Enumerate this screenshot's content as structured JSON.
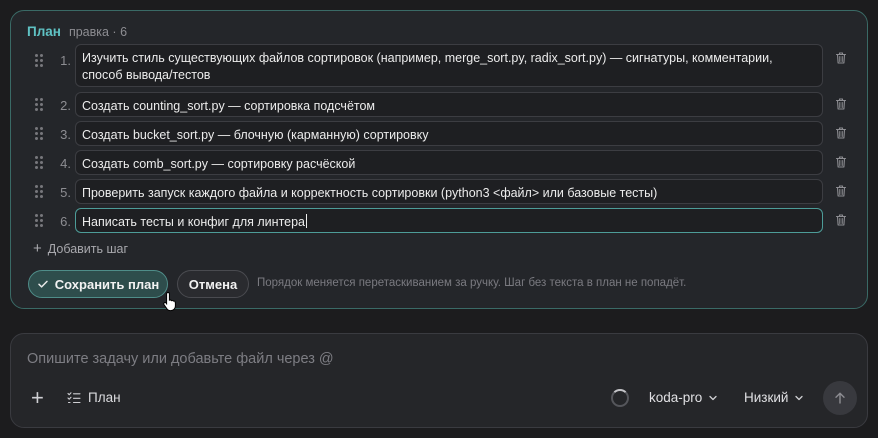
{
  "plan": {
    "title": "План",
    "meta": "правка · 6",
    "steps": [
      {
        "number": "1.",
        "text": "Изучить стиль существующих файлов сортировок (например, merge_sort.py, radix_sort.py) — сигнатуры, комментарии, способ вывода/тестов"
      },
      {
        "number": "2.",
        "text": "Создать counting_sort.py — сортировка подсчётом"
      },
      {
        "number": "3.",
        "text": "Создать bucket_sort.py — блочную (карманную) сортировку"
      },
      {
        "number": "4.",
        "text": "Создать comb_sort.py — сортировку расчёской"
      },
      {
        "number": "5.",
        "text": "Проверить запуск каждого файла и корректность сортировки (python3 <файл> или базовые тесты)"
      },
      {
        "number": "6.",
        "text": "Написать тесты и конфиг для линтера"
      }
    ],
    "add_step_label": "Добавить шаг",
    "save_label": "Сохранить план",
    "cancel_label": "Отмена",
    "hint": "Порядок меняется перетаскиванием за ручку. Шаг без текста в план не попадёт."
  },
  "composer": {
    "placeholder": "Опишите задачу или добавьте файл через @",
    "plan_label": "План",
    "model": "koda-pro",
    "effort": "Низкий"
  },
  "icons": {
    "drag": "drag-handle-icon",
    "trash": "trash-icon",
    "check": "check-icon",
    "plus": "plus-icon",
    "list": "list-checks-icon",
    "chevron": "chevron-down-icon",
    "send": "arrow-up-icon",
    "loading": "spinner-icon",
    "pointer": "hand-pointer-icon"
  },
  "colors": {
    "accent": "#5fc2c4",
    "card_border": "#3a6a66",
    "save_bg": "#2e4d4c"
  }
}
